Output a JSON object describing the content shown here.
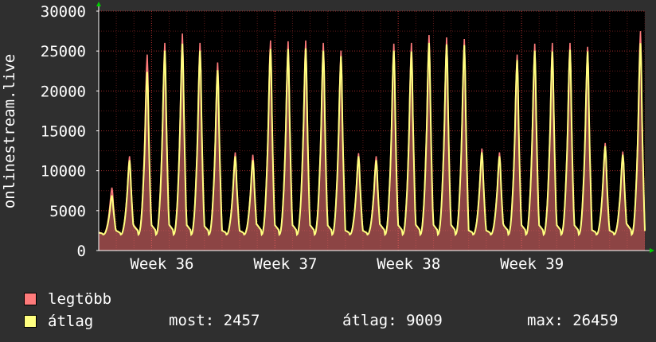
{
  "chart_data": {
    "type": "area",
    "ylabel": "onlinestream.live",
    "ylim": [
      0,
      30000
    ],
    "y_ticks": [
      0,
      5000,
      10000,
      15000,
      20000,
      25000,
      30000
    ],
    "x_ticks": [
      "Week 36",
      "Week 37",
      "Week 38",
      "Week 39"
    ],
    "grid": true,
    "days": 31,
    "daily_peak": {
      "legtöbb": [
        8000,
        12000,
        25000,
        26500,
        27700,
        26500,
        24000,
        12500,
        12200,
        26800,
        26700,
        26800,
        26500,
        25500,
        12400,
        12000,
        26400,
        26500,
        27500,
        27200,
        27000,
        13000,
        12500,
        25000,
        26400,
        26500,
        26500,
        26000,
        13700,
        12600,
        28000
      ],
      "átlag": [
        7000,
        11500,
        22800,
        25500,
        26400,
        25500,
        23000,
        12000,
        11500,
        25700,
        25700,
        25800,
        25500,
        24800,
        12000,
        11500,
        25500,
        25400,
        26500,
        26300,
        26200,
        12500,
        12000,
        24300,
        25500,
        25400,
        25600,
        25400,
        13300,
        12200,
        26459
      ]
    },
    "series": [
      {
        "name": "legtöbb",
        "color": "#ff7b7b"
      },
      {
        "name": "átlag",
        "color": "#ffff80"
      }
    ]
  },
  "legend": {
    "items": [
      {
        "label": "legtöbb",
        "color": "#ff7b7b"
      },
      {
        "label": "átlag",
        "color": "#ffff80"
      }
    ],
    "stats": {
      "most": "most: 2457",
      "atlag": "átlag: 9009",
      "max": "max: 26459"
    }
  }
}
